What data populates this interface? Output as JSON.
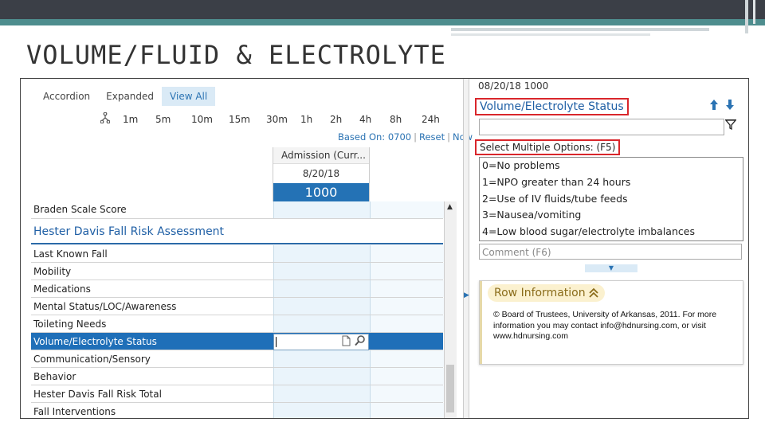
{
  "slide": {
    "title": "VOLUME/FLUID & ELECTROLYTE"
  },
  "view_tabs": [
    {
      "label": "Accordion",
      "active": false
    },
    {
      "label": "Expanded",
      "active": false
    },
    {
      "label": "View All",
      "active": true
    }
  ],
  "timescale": [
    "1m",
    "5m",
    "10m",
    "15m",
    "30m",
    "1h",
    "2h",
    "4h",
    "8h",
    "24h"
  ],
  "based_on": {
    "label": "Based On: 0700",
    "reset": "Reset",
    "now": "Now"
  },
  "column": {
    "header": "Admission (Curr...",
    "date": "8/20/18",
    "time": "1000"
  },
  "rows": [
    {
      "label": "Braden Scale Score"
    },
    {
      "label": "Hester Davis Fall Risk Assessment"
    },
    {
      "label": "Last Known Fall"
    },
    {
      "label": "Mobility"
    },
    {
      "label": "Medications"
    },
    {
      "label": "Mental Status/LOC/Awareness"
    },
    {
      "label": "Toileting Needs"
    },
    {
      "label": "Volume/Electrolyte Status"
    },
    {
      "label": "Communication/Sensory"
    },
    {
      "label": "Behavior"
    },
    {
      "label": "Hester Davis Fall Risk Total"
    },
    {
      "label": "Fall Interventions"
    }
  ],
  "right_panel": {
    "datetime": "08/20/18 1000",
    "title": "Volume/Electrolyte Status",
    "select_label": "Select Multiple Options: (F5)",
    "options": [
      "0=No problems",
      "1=NPO greater than 24 hours",
      "2=Use of IV fluids/tube feeds",
      "3=Nausea/vomiting",
      "4=Low blood sugar/electrolyte imbalances"
    ],
    "comment_placeholder": "Comment (F6)",
    "row_info": {
      "header": "Row Information",
      "text": "© Board of Trustees, University of Arkansas, 2011. For more information you may contact info@hdnursing.com, or visit www.hdnursing.com"
    }
  },
  "colors": {
    "accent": "#2472b5",
    "highlight": "#d9262b",
    "header_band": "#3b3f47",
    "stripe": "#4e8d8e"
  },
  "icons": [
    "hierarchy-icon",
    "up-arrow-icon",
    "down-arrow-icon",
    "filter-icon",
    "document-icon",
    "magnifier-icon",
    "chevron-up-double-icon",
    "scroll-up-icon",
    "expand-right-icon",
    "expand-down-icon"
  ]
}
